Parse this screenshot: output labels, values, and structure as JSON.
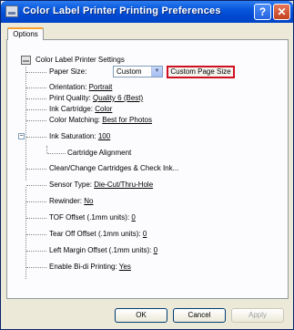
{
  "window": {
    "title": "Color Label Printer Printing Preferences",
    "help_button": "?",
    "close_button": "✕"
  },
  "tabs": [
    {
      "label": "Options",
      "selected": true
    }
  ],
  "tree": {
    "root_label": "Color Label Printer Settings",
    "paper_size": {
      "label": "Paper Size:",
      "value": "Custom",
      "custom_button": "Custom Page Size"
    },
    "items": [
      {
        "label": "Orientation:",
        "value": "Portrait"
      },
      {
        "label": "Print Quality:",
        "value": "Quality 6 (Best)"
      },
      {
        "label": "Ink Cartridge:",
        "value": "Color"
      },
      {
        "label": "Color Matching:",
        "value": "Best for Photos"
      },
      {
        "label": "Ink Saturation:",
        "value": "100"
      },
      {
        "label": "Cartridge Alignment",
        "value": ""
      },
      {
        "label": "Clean/Change Cartridges & Check Ink...",
        "value": ""
      },
      {
        "label": "Sensor Type:",
        "value": "Die-Cut/Thru-Hole"
      },
      {
        "label": "Rewinder:",
        "value": "No"
      },
      {
        "label": "TOF Offset (.1mm units):",
        "value": "0"
      },
      {
        "label": "Tear Off Offset (.1mm units):",
        "value": "0"
      },
      {
        "label": "Left Margin Offset (.1mm units):",
        "value": "0"
      },
      {
        "label": "Enable Bi-di Printing:",
        "value": "Yes"
      }
    ],
    "collapse_symbol": "−"
  },
  "buttons": {
    "ok": "OK",
    "cancel": "Cancel",
    "apply": "Apply"
  },
  "colors": {
    "titlebar": "#0a5ade",
    "highlight_border": "#d01020",
    "tab_accent": "#f7a12d"
  }
}
